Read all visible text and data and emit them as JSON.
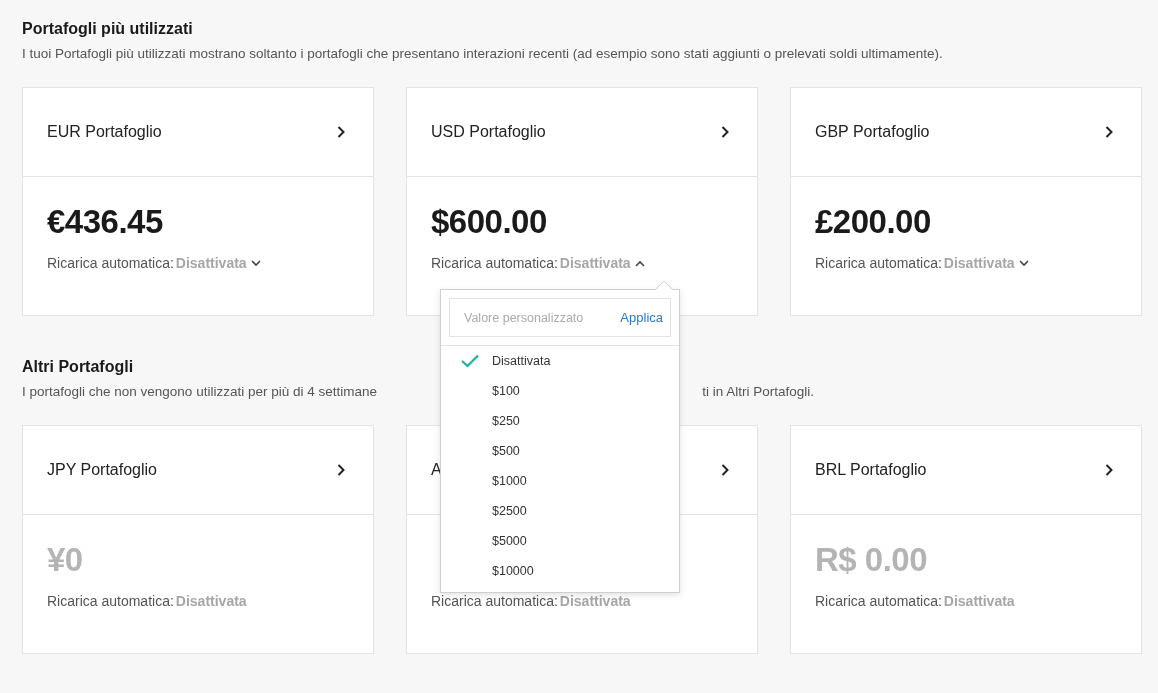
{
  "sections": [
    {
      "title": "Portafogli più utilizzati",
      "description": [
        "I tuoi Portafogli più utilizzati mostrano soltanto i portafogli che presentano interazioni recenti (ad esempio sono stati aggiunti o prelevati soldi ultimamente)."
      ],
      "wallets": [
        {
          "title": "EUR Portafoglio",
          "balance": "€436.45",
          "active": true,
          "autoreload_label": "Ricarica automatica:",
          "autoreload_value": "Disattivata",
          "expanded": false
        },
        {
          "title": "USD Portafoglio",
          "balance": "$600.00",
          "active": true,
          "autoreload_label": "Ricarica automatica:",
          "autoreload_value": "Disattivata",
          "expanded": true,
          "dropdown": {
            "placeholder": "Valore personalizzato",
            "apply": "Applica",
            "options": [
              {
                "label": "Disattivata",
                "selected": true
              },
              {
                "label": "$100",
                "selected": false
              },
              {
                "label": "$250",
                "selected": false
              },
              {
                "label": "$500",
                "selected": false
              },
              {
                "label": "$1000",
                "selected": false
              },
              {
                "label": "$2500",
                "selected": false
              },
              {
                "label": "$5000",
                "selected": false
              },
              {
                "label": "$10000",
                "selected": false
              }
            ]
          }
        },
        {
          "title": "GBP Portafoglio",
          "balance": "£200.00",
          "active": true,
          "autoreload_label": "Ricarica automatica:",
          "autoreload_value": "Disattivata",
          "expanded": false
        }
      ]
    },
    {
      "title": "Altri Portafogli",
      "description": [
        "I portafogli che non vengono utilizzati per più di 4 settimane",
        "ti in Altri Portafogli."
      ],
      "wallets": [
        {
          "title": "JPY Portafoglio",
          "balance": "¥0",
          "active": false,
          "autoreload_label": "Ricarica automatica:",
          "autoreload_value": "Disattivata"
        },
        {
          "title": "A",
          "autoreload_label": "Ricarica automatica:",
          "autoreload_value": "Disattivata"
        },
        {
          "title": "BRL Portafoglio",
          "balance": "R$ 0.00",
          "active": false,
          "autoreload_label": "Ricarica automatica:",
          "autoreload_value": "Disattivata"
        }
      ]
    }
  ]
}
